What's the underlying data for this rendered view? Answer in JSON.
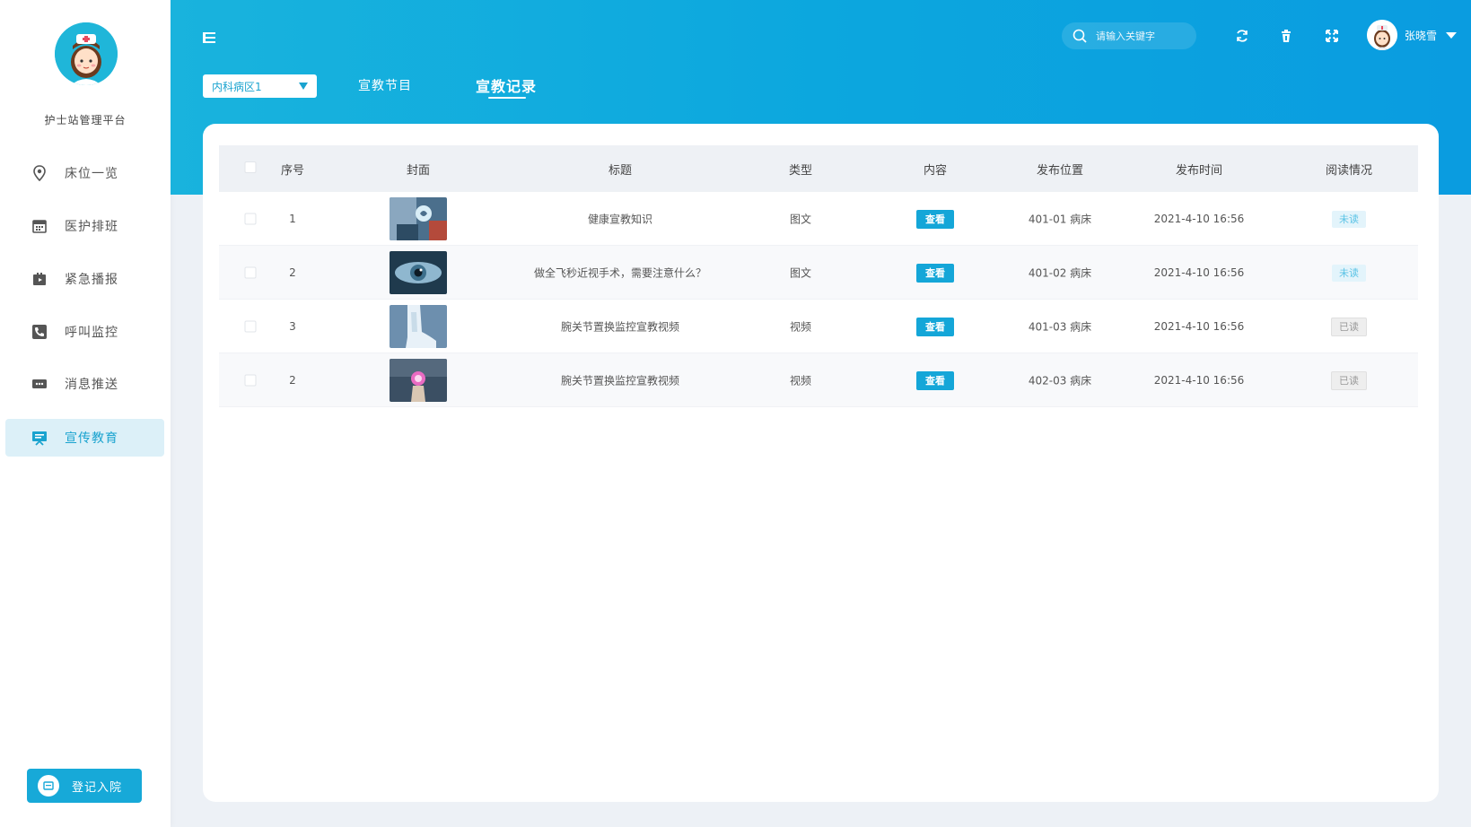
{
  "sidebar": {
    "brand": "护士站管理平台",
    "items": [
      {
        "label": "床位一览",
        "icon": "location-pin-icon"
      },
      {
        "label": "医护排班",
        "icon": "calendar-icon"
      },
      {
        "label": "紧急播报",
        "icon": "broadcast-icon"
      },
      {
        "label": "呼叫监控",
        "icon": "phone-icon"
      },
      {
        "label": "消息推送",
        "icon": "message-icon"
      },
      {
        "label": "宣传教育",
        "icon": "presentation-icon",
        "active": true
      }
    ],
    "register_label": "登记入院"
  },
  "header": {
    "search_placeholder": "请输入关键字",
    "user_name": "张晓雪"
  },
  "tabs": {
    "ward_select": "内科病区1",
    "items": [
      "宣教节目",
      "宣教记录"
    ],
    "active": "宣教记录"
  },
  "table": {
    "headers": [
      "序号",
      "封面",
      "标题",
      "类型",
      "内容",
      "发布位置",
      "发布时间",
      "阅读情况"
    ],
    "view_label": "查看",
    "rows": [
      {
        "index": "1",
        "title": "健康宣教知识",
        "type": "图文",
        "location": "401-01 病床",
        "time": "2021-4-10  16:56",
        "status": "未读",
        "read": false
      },
      {
        "index": "2",
        "title": "做全飞秒近视手术，需要注意什么？",
        "type": "图文",
        "location": "401-02 病床",
        "time": "2021-4-10  16:56",
        "status": "未读",
        "read": false
      },
      {
        "index": "3",
        "title": "腕关节置换监控宣教视频",
        "type": "视频",
        "location": "401-03 病床",
        "time": "2021-4-10  16:56",
        "status": "已读",
        "read": true
      },
      {
        "index": "2",
        "title": "腕关节置换监控宣教视频",
        "type": "视频",
        "location": "402-03 病床",
        "time": "2021-4-10  16:56",
        "status": "已读",
        "read": true
      }
    ]
  },
  "colors": {
    "accent": "#17a9d8",
    "header_start": "#19b3dd",
    "header_end": "#0a9ce0",
    "active_nav_bg": "#dcf0f8"
  }
}
